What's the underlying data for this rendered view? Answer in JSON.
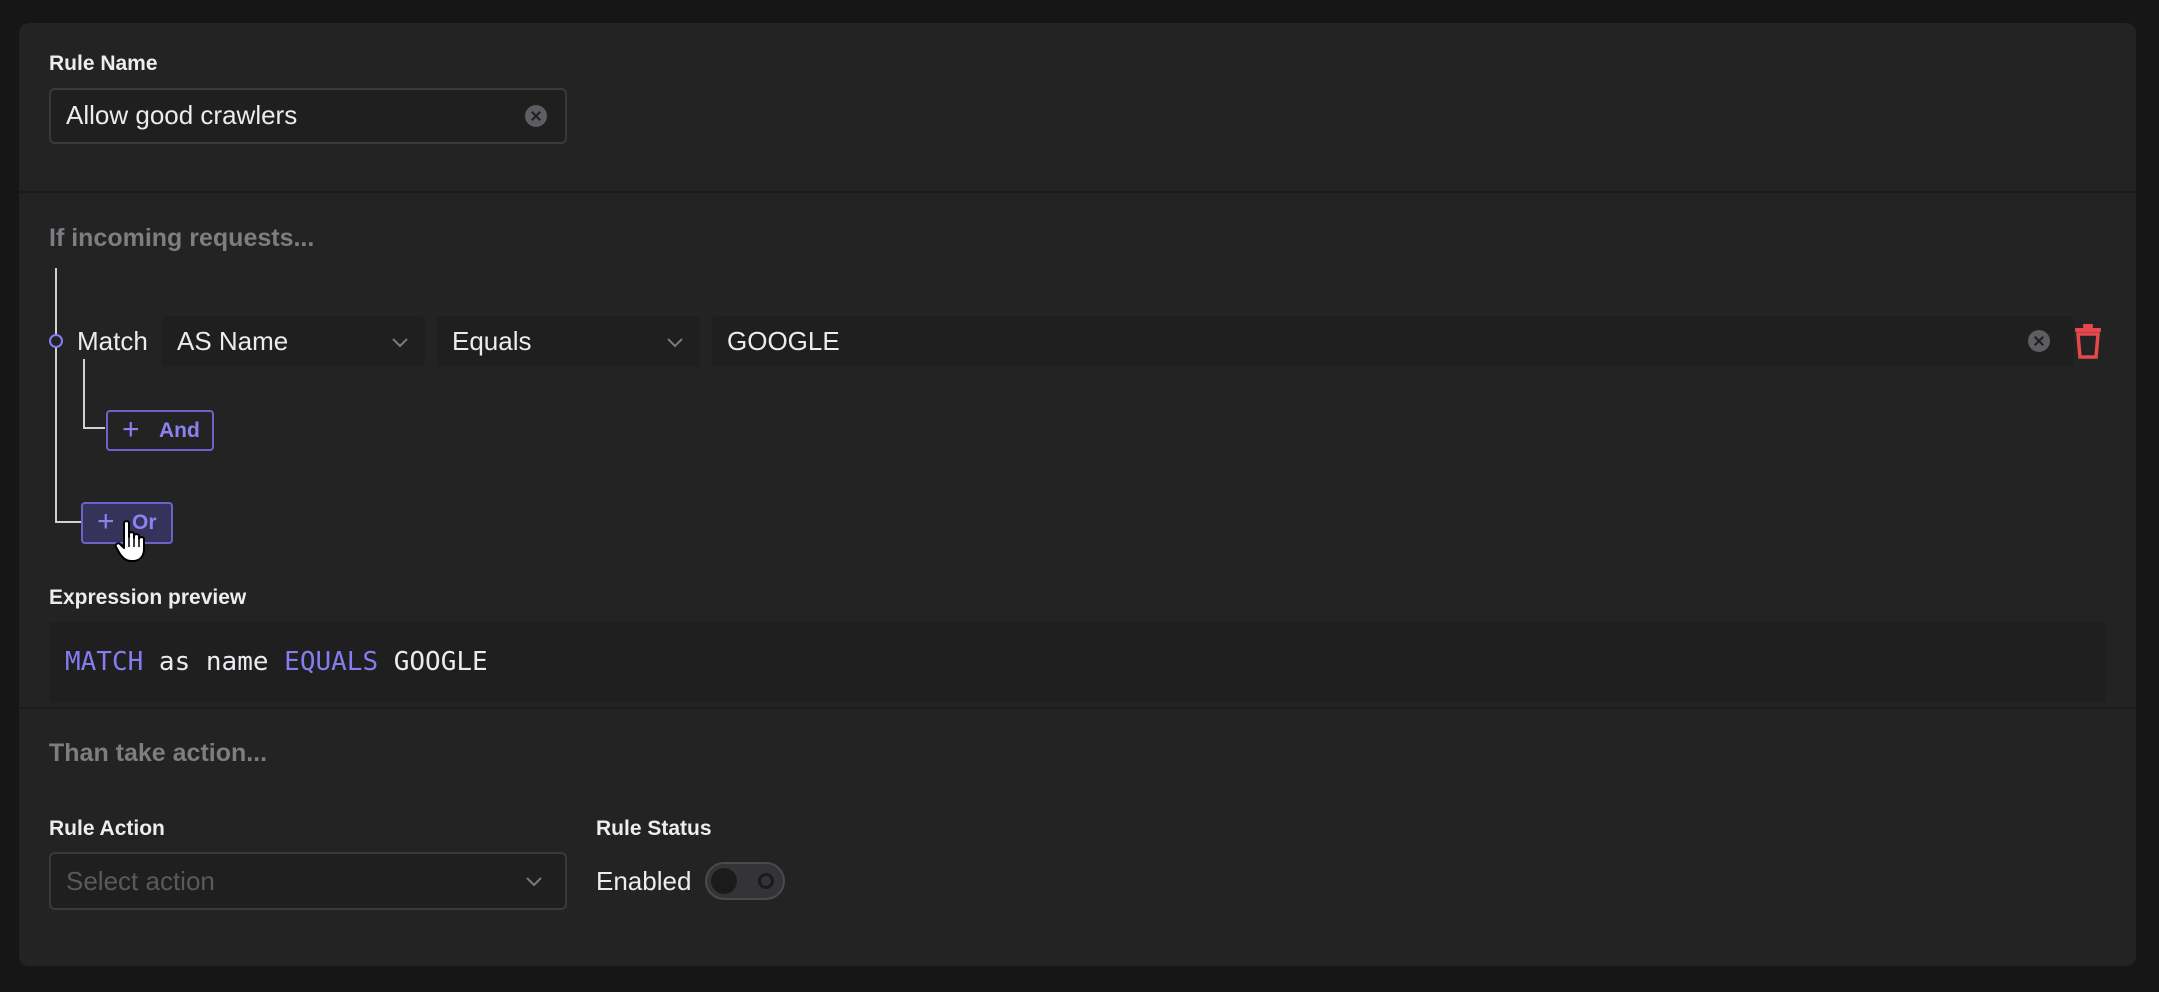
{
  "rule_name": {
    "label": "Rule Name",
    "value": "Allow good crawlers"
  },
  "conditions": {
    "title": "If incoming requests...",
    "rows": [
      {
        "operator_label": "Match",
        "field": "AS Name",
        "comparator": "Equals",
        "value": "GOOGLE"
      }
    ],
    "and_button": "And",
    "or_button": "Or"
  },
  "expression_preview": {
    "label": "Expression preview",
    "tokens": {
      "t1": "MATCH",
      "t2": " as name ",
      "t3": "EQUALS",
      "t4": " GOOGLE"
    }
  },
  "action": {
    "title": "Than take action...",
    "rule_action_label": "Rule Action",
    "rule_action_placeholder": "Select action",
    "rule_status_label": "Rule Status",
    "rule_status_value": "Enabled",
    "rule_status_on": false
  },
  "colors": {
    "accent": "#8b82f0",
    "danger": "#e5484d",
    "panel": "#232323",
    "background": "#161616"
  }
}
